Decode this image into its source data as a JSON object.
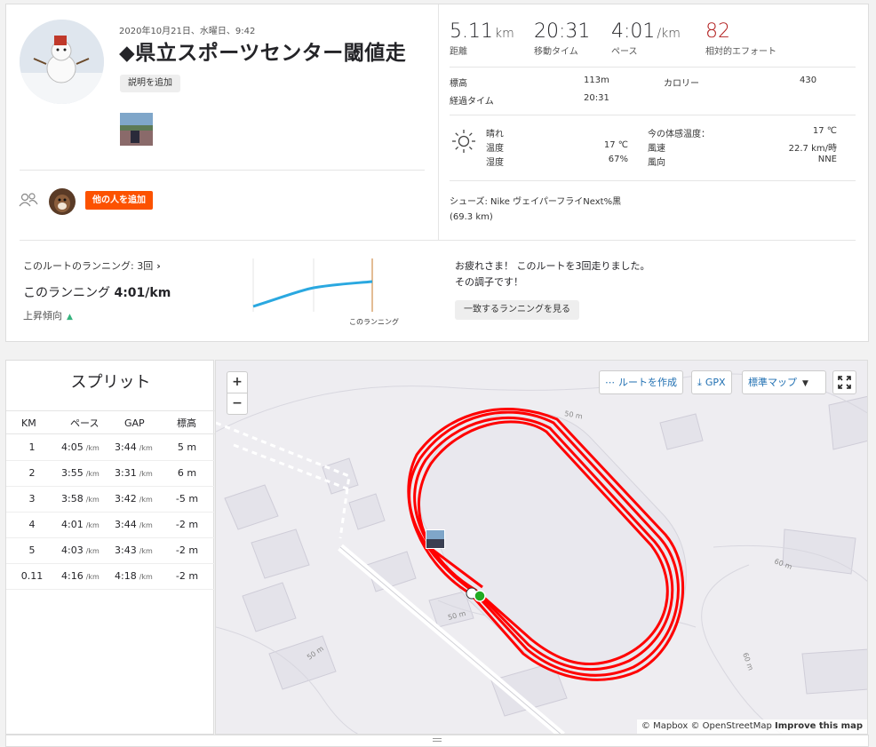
{
  "activity": {
    "date": "2020年10月21日、水曜日、9:42",
    "title": "◆県立スポーツセンター閾値走",
    "add_description": "説明を追加",
    "add_others": "他の人を追加"
  },
  "stats": [
    {
      "value": "5.11",
      "unit": "km",
      "label": "距離"
    },
    {
      "value": "20:31",
      "unit": "",
      "label": "移動タイム"
    },
    {
      "value": "4:01",
      "unit": "/km",
      "label": "ペース"
    },
    {
      "value": "82",
      "unit": "",
      "label": "相対的エフォート"
    }
  ],
  "details": {
    "elevation_label": "標高",
    "elevation": "113m",
    "calories_label": "カロリー",
    "calories": "430",
    "elapsed_label": "経過タイム",
    "elapsed": "20:31"
  },
  "weather": {
    "condition": "晴れ",
    "temp_label": "温度",
    "temp": "17 ℃",
    "humidity_label": "湿度",
    "humidity": "67%",
    "feels_label": "今の体感温度：",
    "feels": "17 ℃",
    "wind_speed_label": "風速",
    "wind_speed": "22.7 km/時",
    "wind_dir_label": "風向",
    "wind_dir": "NNE",
    "icon": "sun-icon"
  },
  "shoes": "シューズ: Nike ヴェイパーフライNext%黒 (69.3 km)",
  "route": {
    "runs_link": "このルートのランニング: 3回",
    "this_run_prefix": "このランニング",
    "this_run_pace": "4:01/km",
    "trend": "上昇傾向",
    "chart_label": "このランニング",
    "congrats": "お疲れさま！ このルートを3回走りました。その調子です！",
    "match_button": "一致するランニングを見る"
  },
  "splits": {
    "title": "スプリット",
    "headers": {
      "km": "KM",
      "pace": "ペース",
      "gap": "GAP",
      "elev": "標高"
    },
    "unit": "/km",
    "rows": [
      {
        "km": "1",
        "pace": "4:05",
        "gap": "3:44",
        "elev": "5 m"
      },
      {
        "km": "2",
        "pace": "3:55",
        "gap": "3:31",
        "elev": "6 m"
      },
      {
        "km": "3",
        "pace": "3:58",
        "gap": "3:42",
        "elev": "-5 m"
      },
      {
        "km": "4",
        "pace": "4:01",
        "gap": "3:44",
        "elev": "-2 m"
      },
      {
        "km": "5",
        "pace": "4:03",
        "gap": "3:43",
        "elev": "-2 m"
      },
      {
        "km": "0.11",
        "pace": "4:16",
        "gap": "4:18",
        "elev": "-2 m"
      }
    ]
  },
  "map": {
    "zoom_in": "+",
    "zoom_out": "−",
    "create_route": "ルートを作成",
    "gpx": "GPX",
    "map_style": "標準マップ",
    "attribution_1": "© Mapbox © OpenStreetMap",
    "attribution_2": "Improve this map",
    "contour_labels": [
      "50 m",
      "50 m",
      "50 m",
      "60 m",
      "60 m"
    ],
    "route_color": "#ff0000"
  },
  "colors": {
    "accent": "#fc5200",
    "effort": "#b11c1c",
    "trend_line": "#2aa8e0"
  }
}
